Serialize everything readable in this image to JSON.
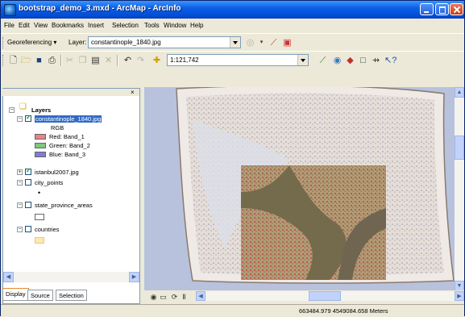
{
  "window": {
    "title": "bootstrap_demo_3.mxd - ArcMap - ArcInfo"
  },
  "menu": [
    "File",
    "Edit",
    "View",
    "Bookmarks",
    "Insert",
    "Selection",
    "Tools",
    "Window",
    "Help"
  ],
  "georef_toolbar": {
    "georeferencing_label": "Georeferencing ▾",
    "layer_label": "Layer:",
    "layer_value": "constantinople_1840.jpg"
  },
  "standard_toolbar": {
    "scale_value": "1:121,742"
  },
  "toc": {
    "root_label": "Layers",
    "layers": [
      {
        "label": "constantinople_1840.jpg",
        "checked": true,
        "expanded": true,
        "selected": true
      },
      {
        "label": "istanbul2007.jpg",
        "checked": true,
        "expanded": false
      },
      {
        "label": "city_points",
        "checked": false,
        "expanded": true
      },
      {
        "label": "state_province_areas",
        "checked": false,
        "expanded": true
      },
      {
        "label": "countries",
        "checked": false,
        "expanded": true
      }
    ],
    "rgb_heading": "RGB",
    "bands": [
      {
        "label": "Red:  Band_1",
        "color": "#e8838a"
      },
      {
        "label": "Green: Band_2",
        "color": "#7ec87e"
      },
      {
        "label": "Blue:  Band_3",
        "color": "#7f7fd0"
      }
    ],
    "tabs": [
      "Display",
      "Source",
      "Selection"
    ]
  },
  "status": {
    "coordinates": "663484.979  4549084.658 Meters"
  },
  "colors": {
    "title_blue": "#0a5fe6",
    "map_background": "#b8c2dc",
    "selection": "#316ac5"
  }
}
